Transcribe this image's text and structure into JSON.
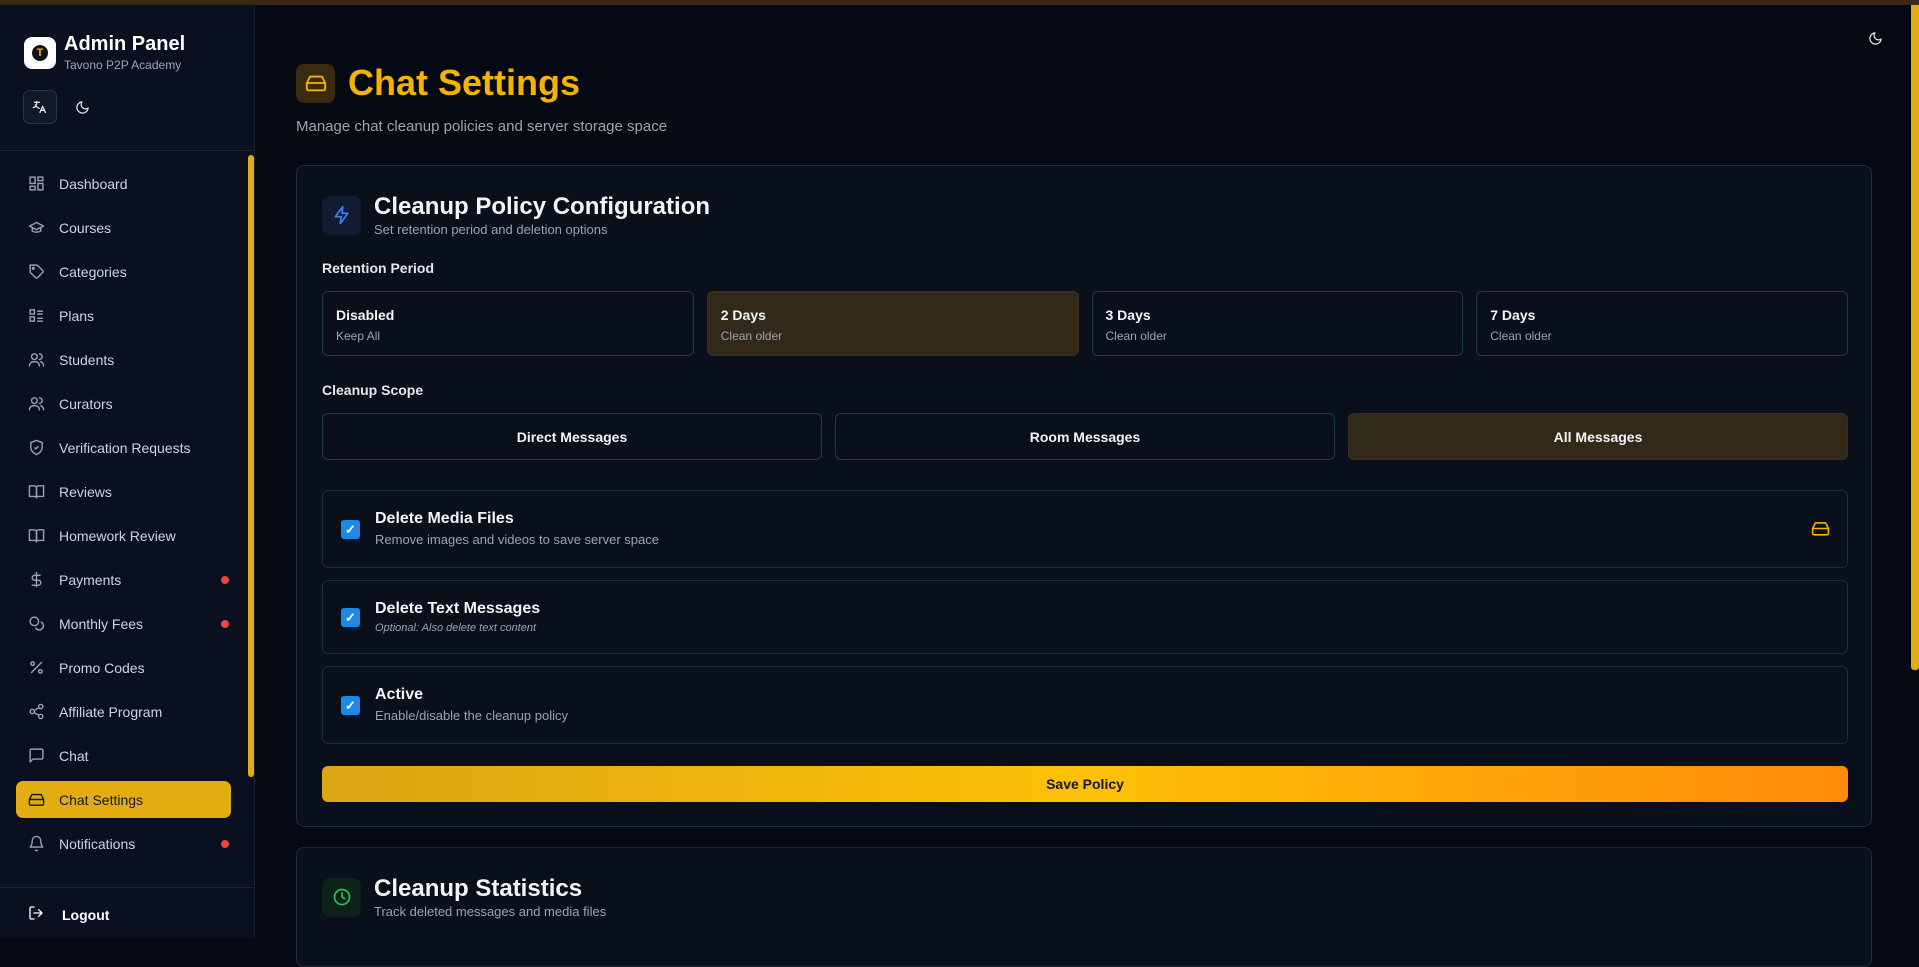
{
  "sidebar": {
    "title": "Admin Panel",
    "subtitle": "Tavono P2P Academy",
    "items": [
      {
        "label": "Dashboard",
        "icon": "grid-icon"
      },
      {
        "label": "Courses",
        "icon": "graduation-cap-icon"
      },
      {
        "label": "Categories",
        "icon": "tag-icon"
      },
      {
        "label": "Plans",
        "icon": "list-icon"
      },
      {
        "label": "Students",
        "icon": "users-icon"
      },
      {
        "label": "Curators",
        "icon": "users-icon"
      },
      {
        "label": "Verification Requests",
        "icon": "shield-check-icon"
      },
      {
        "label": "Reviews",
        "icon": "book-open-icon"
      },
      {
        "label": "Homework Review",
        "icon": "book-open-icon"
      },
      {
        "label": "Payments",
        "icon": "dollar-icon"
      },
      {
        "label": "Monthly Fees",
        "icon": "coins-icon"
      },
      {
        "label": "Promo Codes",
        "icon": "percent-icon"
      },
      {
        "label": "Affiliate Program",
        "icon": "share-icon"
      },
      {
        "label": "Chat",
        "icon": "message-square-icon"
      },
      {
        "label": "Chat Settings",
        "icon": "hard-drive-icon"
      },
      {
        "label": "Notifications",
        "icon": "bell-icon"
      }
    ],
    "logout": "Logout"
  },
  "page": {
    "title": "Chat Settings",
    "subtitle": "Manage chat cleanup policies and server storage space"
  },
  "policy": {
    "title": "Cleanup Policy Configuration",
    "desc": "Set retention period and deletion options",
    "retention_label": "Retention Period",
    "retention": [
      {
        "name": "Disabled",
        "sub": "Keep All"
      },
      {
        "name": "2 Days",
        "sub": "Clean older"
      },
      {
        "name": "3 Days",
        "sub": "Clean older"
      },
      {
        "name": "7 Days",
        "sub": "Clean older"
      }
    ],
    "retention_selected": "2 Days",
    "scope_label": "Cleanup Scope",
    "scope": [
      "Direct Messages",
      "Room Messages",
      "All Messages"
    ],
    "scope_selected": "All Messages",
    "options": [
      {
        "title": "Delete Media Files",
        "desc": "Remove images and videos to save server space",
        "checked": true
      },
      {
        "title": "Delete Text Messages",
        "desc": "Optional: Also delete text content",
        "checked": true
      },
      {
        "title": "Active",
        "desc": "Enable/disable the cleanup policy",
        "checked": true
      }
    ],
    "save_label": "Save Policy"
  },
  "stats": {
    "title": "Cleanup Statistics",
    "desc": "Track deleted messages and media files"
  },
  "colors": {
    "accent": "#f5b301",
    "background": "#050914",
    "sidebar": "#0b1020",
    "checkbox": "#1e88e5",
    "badge": "#ef4444"
  }
}
